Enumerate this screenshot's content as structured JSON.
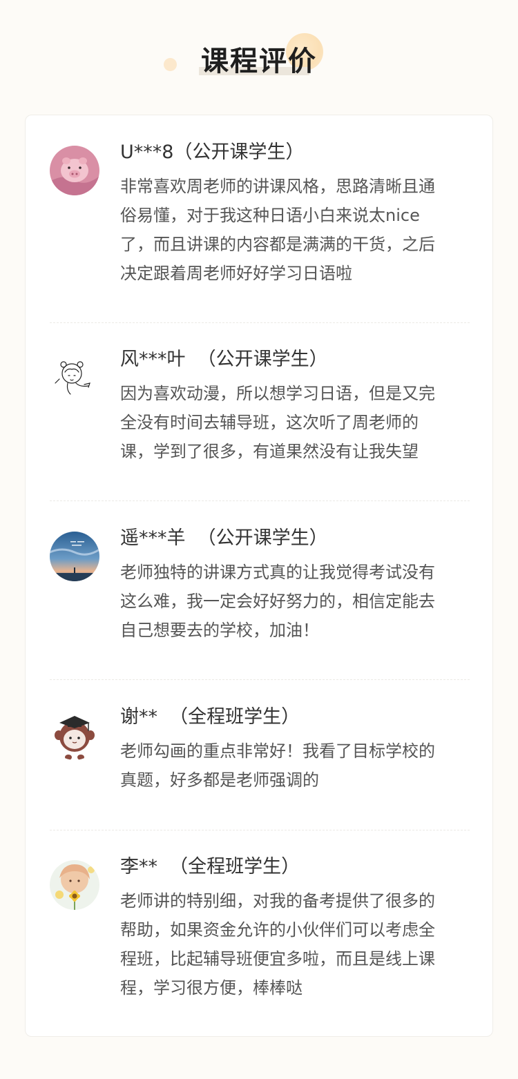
{
  "header": {
    "title": "课程评价"
  },
  "reviews": [
    {
      "name": "U***8（公开课学生）",
      "lines": [
        "非常喜欢周老师的讲课风格，思路清晰且通",
        "俗易懂，对于我这种日语小白来说太nice",
        "了，而且讲课的内容都是满满的干货，之后",
        "决定跟着周老师好好学习日语啦"
      ],
      "avatar_icon": "pig-avatar-icon"
    },
    {
      "name": "风***叶  （公开课学生）",
      "lines": [
        "因为喜欢动漫，所以想学习日语，但是又完",
        "全没有时间去辅导班，这次听了周老师的",
        "课，学到了很多，有道果然没有让我失望"
      ],
      "avatar_icon": "sketch-girl-avatar-icon"
    },
    {
      "name": "遥***羊  （公开课学生）",
      "lines": [
        "老师独特的讲课方式真的让我觉得考试没有",
        "这么难，我一定会好好努力的，相信定能去",
        "自己想要去的学校，加油！"
      ],
      "avatar_icon": "sky-scene-avatar-icon"
    },
    {
      "name": "谢**  （全程班学生）",
      "lines": [
        "老师勾画的重点非常好！我看了目标学校的",
        "真题，好多都是老师强调的"
      ],
      "avatar_icon": "graduate-monkey-avatar-icon"
    },
    {
      "name": "李**  （全程班学生）",
      "lines": [
        "老师讲的特别细，对我的备考提供了很多的",
        "帮助，如果资金允许的小伙伴们可以考虑全",
        "程班，比起辅导班便宜多啦，而且是线上课",
        "程，学习很方便，棒棒哒"
      ],
      "avatar_icon": "sunflower-girl-avatar-icon"
    }
  ],
  "colors": {
    "background": "#fdfbf7",
    "card": "#ffffff",
    "name_text": "#333333",
    "body_text": "#555555"
  }
}
